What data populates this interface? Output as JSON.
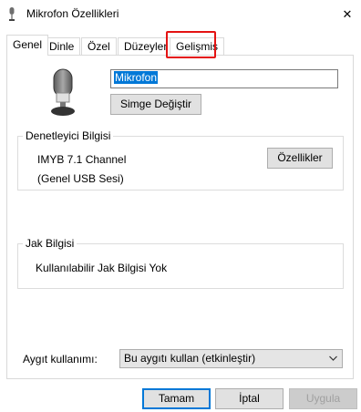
{
  "window": {
    "title": "Mikrofon Özellikleri",
    "close_glyph": "✕"
  },
  "tabs": [
    {
      "label": "Genel",
      "active": true
    },
    {
      "label": "Dinle"
    },
    {
      "label": "Özel"
    },
    {
      "label": "Düzeyler"
    },
    {
      "label": "Gelişmiş",
      "highlighted": true
    }
  ],
  "general": {
    "device_name": "Mikrofon",
    "change_icon_label": "Simge Değiştir",
    "controller": {
      "legend": "Denetleyici Bilgisi",
      "name": "IMYB 7.1 Channel",
      "sub": "(Genel USB Sesi)",
      "properties_label": "Özellikler"
    },
    "jack": {
      "legend": "Jak Bilgisi",
      "text": "Kullanılabilir Jak Bilgisi Yok"
    },
    "usage": {
      "label": "Aygıt kullanımı:",
      "value": "Bu aygıtı kullan (etkinleştir)"
    }
  },
  "footer": {
    "ok_label": "Tamam",
    "cancel_label": "İptal",
    "apply_label": "Uygula"
  },
  "colors": {
    "accent": "#0078d7",
    "highlight_box": "#e41313"
  },
  "icons": {
    "title": "microphone-icon",
    "device": "microphone-icon",
    "dropdown": "chevron-down-icon"
  }
}
